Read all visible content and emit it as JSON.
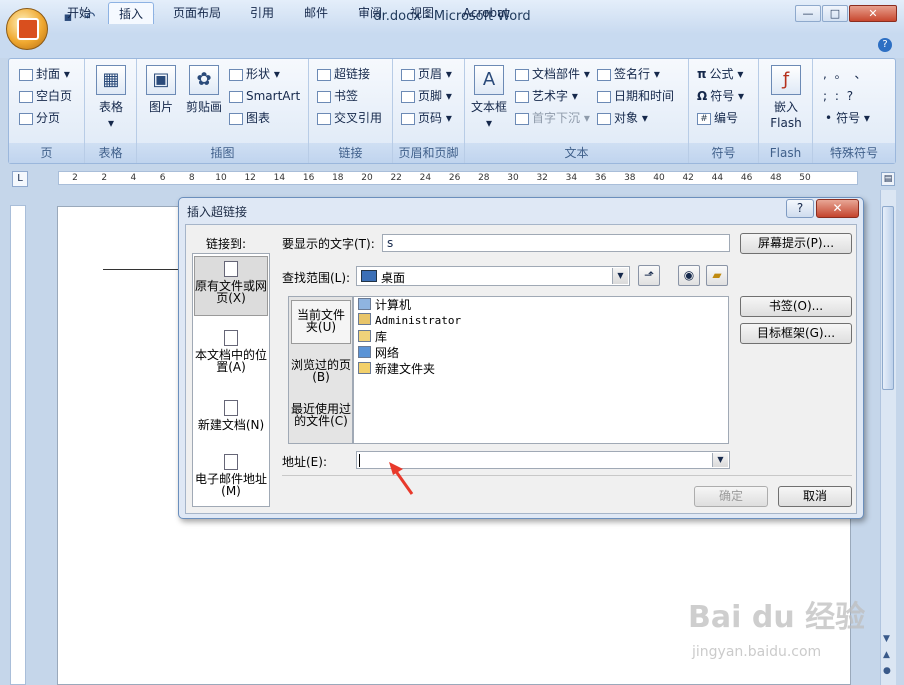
{
  "window": {
    "title": "dr.docx - Microsoft Word",
    "min_label": "—",
    "max_label": "□",
    "close_label": "✕"
  },
  "quick_access": {
    "save": "▪",
    "undo": "↶",
    "redo": "↻",
    "more": "▾"
  },
  "tabs": [
    "开始",
    "插入",
    "页面布局",
    "引用",
    "邮件",
    "审阅",
    "视图",
    "Acrobat"
  ],
  "active_tab": "插入",
  "ribbon": {
    "pages": {
      "label": "页",
      "items": [
        "封面 ▾",
        "空白页",
        "分页"
      ]
    },
    "tables": {
      "label": "表格",
      "button": "表格"
    },
    "illustrations": {
      "label": "插图",
      "picture": "图片",
      "clipart": "剪贴画",
      "shapes": "形状 ▾",
      "smartart": "SmartArt",
      "chart": "图表"
    },
    "links": {
      "label": "链接",
      "items": [
        "超链接",
        "书签",
        "交叉引用"
      ]
    },
    "header_footer": {
      "label": "页眉和页脚",
      "items": [
        "页眉 ▾",
        "页脚 ▾",
        "页码 ▾"
      ]
    },
    "text": {
      "label": "文本",
      "textbox": "文本框",
      "items": [
        "文档部件 ▾",
        "艺术字 ▾",
        "首字下沉 ▾",
        "签名行 ▾",
        "日期和时间",
        "对象 ▾"
      ]
    },
    "symbols": {
      "label": "符号",
      "items": [
        "公式 ▾",
        "符号 ▾",
        "编号"
      ]
    },
    "flash": {
      "label": "Flash",
      "button_line1": "嵌入",
      "button_line2": "Flash"
    },
    "special": {
      "label": "特殊符号",
      "row1": ",  。  、",
      "row2": ";  :  ?",
      "symbol": "符号 ▾"
    }
  },
  "ruler": {
    "ticks": [
      "2",
      "2",
      "4",
      "6",
      "8",
      "10",
      "12",
      "14",
      "16",
      "18",
      "20",
      "22",
      "24",
      "26",
      "28",
      "30",
      "32",
      "34",
      "36",
      "38",
      "40",
      "42",
      "44",
      "46",
      "48",
      "50"
    ]
  },
  "dialog": {
    "title": "插入超链接",
    "help": "?",
    "close": "✕",
    "link_to_label": "链接到:",
    "display_text_label": "要显示的文字(T):",
    "display_text_value": "s",
    "screentip_button": "屏幕提示(P)...",
    "look_in_label": "查找范围(L):",
    "look_in_value": "桌面",
    "link_targets": [
      "原有文件或网页(X)",
      "本文档中的位置(A)",
      "新建文档(N)",
      "电子邮件地址(M)"
    ],
    "nav_items": [
      "当前文件夹(U)",
      "浏览过的页(B)",
      "最近使用过的文件(C)"
    ],
    "files": [
      "计算机",
      "Administrator",
      "库",
      "网络",
      "新建文件夹"
    ],
    "bookmark_button": "书签(O)...",
    "target_frame_button": "目标框架(G)...",
    "address_label": "地址(E):",
    "address_value": "",
    "ok_button": "确定",
    "cancel_button": "取消"
  },
  "watermark": {
    "brand": "Bai du 经验",
    "url": "jingyan.baidu.com"
  },
  "colors": {
    "ribbon_bg": "#dde8f6",
    "dialog_bg": "#dfe8f5",
    "close_red": "#c4442d",
    "annotation_arrow": "#e8392b"
  }
}
